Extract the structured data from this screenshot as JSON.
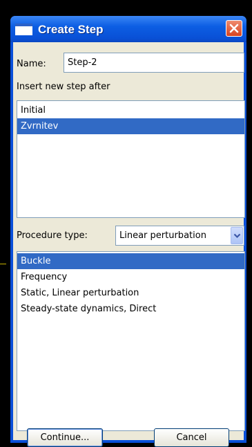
{
  "window": {
    "title": "Create Step"
  },
  "form": {
    "name_label": "Name:",
    "name_value": "Step-2",
    "insert_label": "Insert new step after",
    "steps": [
      "Initial",
      "Zvrnitev"
    ],
    "selected_step": "Zvrnitev",
    "procedure_label": "Procedure type:",
    "procedure_value": "Linear perturbation",
    "procedures": [
      "Buckle",
      "Frequency",
      "Static, Linear perturbation",
      "Steady-state dynamics, Direct"
    ],
    "selected_procedure": "Buckle"
  },
  "buttons": {
    "continue_label": "Continue...",
    "cancel_label": "Cancel"
  },
  "icons": {
    "window": "window-icon",
    "close": "close-icon",
    "dropdown": "chevron-down-icon"
  },
  "colors": {
    "selection": "#316ac5",
    "titlebar": "#0a50d6",
    "dialog_bg": "#ece9d8"
  }
}
